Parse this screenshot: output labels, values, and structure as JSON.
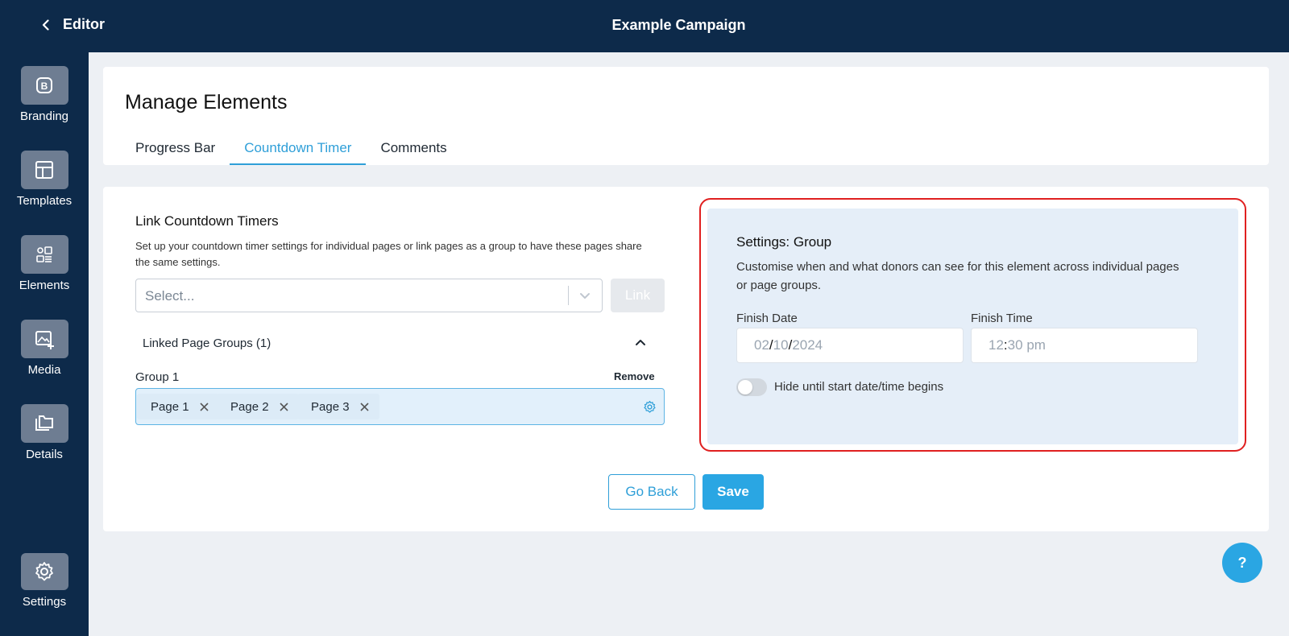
{
  "header": {
    "back_label": "Editor",
    "campaign_title": "Example Campaign"
  },
  "sidebar": {
    "items": [
      {
        "label": "Branding",
        "icon": "branding-icon"
      },
      {
        "label": "Templates",
        "icon": "templates-icon"
      },
      {
        "label": "Elements",
        "icon": "elements-icon"
      },
      {
        "label": "Media",
        "icon": "media-icon"
      },
      {
        "label": "Details",
        "icon": "details-icon"
      }
    ],
    "settings_label": "Settings"
  },
  "page": {
    "title": "Manage Elements",
    "tabs": [
      {
        "label": "Progress Bar",
        "active": false
      },
      {
        "label": "Countdown Timer",
        "active": true
      },
      {
        "label": "Comments",
        "active": false
      }
    ]
  },
  "link_timers": {
    "title": "Link Countdown Timers",
    "description": "Set up your countdown timer settings for individual pages or link pages as a group to have these pages share the same settings.",
    "select_placeholder": "Select...",
    "link_button": "Link",
    "groups_heading": "Linked Page Groups (1)",
    "group": {
      "label": "Group 1",
      "remove_label": "Remove",
      "pages": [
        "Page 1",
        "Page 2",
        "Page 3"
      ]
    }
  },
  "settings": {
    "title": "Settings: Group",
    "description": "Customise when and what donors can see for this element across individual pages or page groups.",
    "finish_date_label": "Finish Date",
    "finish_date": {
      "day": "02",
      "month": "10",
      "year": "2024"
    },
    "finish_time_label": "Finish Time",
    "finish_time": {
      "hour": "12",
      "minute": "30",
      "period": "pm"
    },
    "hide_toggle_label": "Hide until start date/time begins",
    "hide_toggle_on": false
  },
  "actions": {
    "go_back": "Go Back",
    "save": "Save"
  },
  "help_label": "?",
  "colors": {
    "navy": "#0d2a4a",
    "accent": "#2aa6e3",
    "highlight_border": "#e02020"
  }
}
